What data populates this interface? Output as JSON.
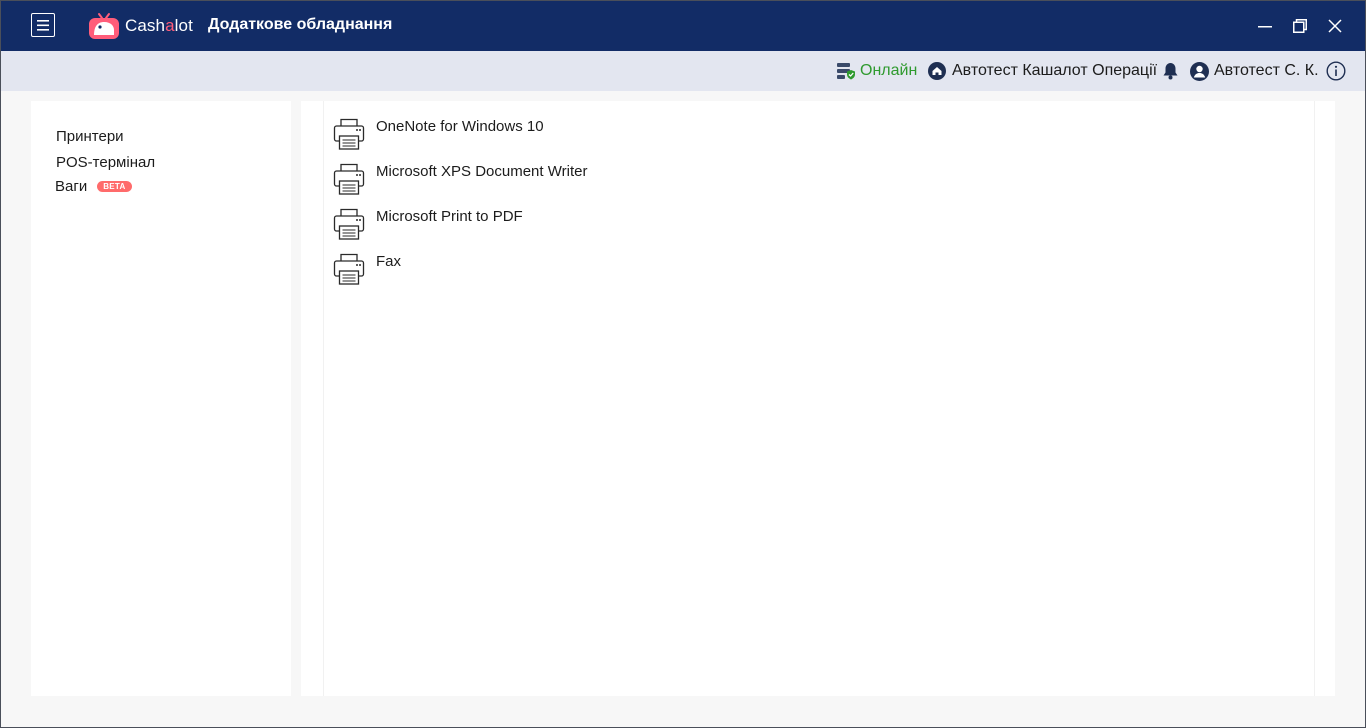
{
  "app": {
    "logo_text_pre": "Cash",
    "logo_text_accent": "a",
    "logo_text_post": "lot",
    "page_title": "Додаткове обладнання"
  },
  "status": {
    "connection": "Онлайн",
    "store": "Автотест Кашалот Операції",
    "user": "Автотест С. К."
  },
  "sidebar": {
    "items": [
      {
        "label": "Принтери"
      },
      {
        "label": "POS-термінал"
      },
      {
        "label": "Ваги",
        "badge": "BETA"
      }
    ]
  },
  "printers": [
    {
      "name": "OneNote for Windows 10"
    },
    {
      "name": "Microsoft XPS Document Writer"
    },
    {
      "name": "Microsoft Print to PDF"
    },
    {
      "name": "Fax"
    }
  ],
  "colors": {
    "titlebar": "#122c66",
    "statusbar": "#e3e6f0",
    "online": "#2f9a2f",
    "beta_badge": "#ff6b6b",
    "logo_accent": "#ff5d7a"
  },
  "icons": {
    "menu": "hamburger-icon",
    "connection": "server-check-icon",
    "store": "home-icon",
    "notifications": "bell-icon",
    "user": "user-circle-icon",
    "info": "info-icon",
    "printer": "printer-icon"
  }
}
